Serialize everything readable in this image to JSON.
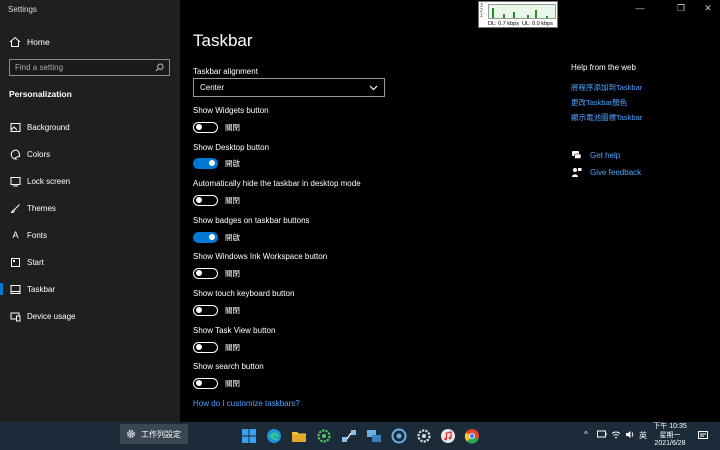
{
  "window": {
    "title": "Settings",
    "minimize": "—",
    "maximize": "❐",
    "close": "✕"
  },
  "sidebar": {
    "home": "Home",
    "search_placeholder": "Find a setting",
    "section": "Personalization",
    "items": [
      {
        "label": "Background",
        "icon": "picture-icon"
      },
      {
        "label": "Colors",
        "icon": "palette-icon"
      },
      {
        "label": "Lock screen",
        "icon": "lock-screen-icon"
      },
      {
        "label": "Themes",
        "icon": "brush-icon"
      },
      {
        "label": "Fonts",
        "icon": "font-icon"
      },
      {
        "label": "Start",
        "icon": "start-icon"
      },
      {
        "label": "Taskbar",
        "icon": "taskbar-icon",
        "active": true
      },
      {
        "label": "Device usage",
        "icon": "device-icon"
      }
    ]
  },
  "netmeter": {
    "scale": [
      "1",
      "2",
      "3"
    ],
    "download": "DL: 0.7 kbps",
    "upload": "UL: 0.0 kbps"
  },
  "main": {
    "title": "Taskbar",
    "alignment_label": "Taskbar alignment",
    "alignment_value": "Center",
    "settings": [
      {
        "label": "Show Widgets button",
        "state": "關閉",
        "on": false
      },
      {
        "label": "Show Desktop button",
        "state": "開啟",
        "on": true
      },
      {
        "label": "Automatically hide the taskbar in desktop mode",
        "state": "關閉",
        "on": false
      },
      {
        "label": "Show badges on taskbar buttons",
        "state": "開啟",
        "on": true
      },
      {
        "label": "Show Windows Ink Workspace button",
        "state": "關閉",
        "on": false
      },
      {
        "label": "Show touch keyboard button",
        "state": "關閉",
        "on": false
      },
      {
        "label": "Show Task View button",
        "state": "關閉",
        "on": false
      },
      {
        "label": "Show search button",
        "state": "關閉",
        "on": false
      }
    ],
    "customize_link": "How do I customize taskbars?"
  },
  "help": {
    "title": "Help from the web",
    "links": [
      "將程序添加到Taskbar",
      "更改Taskbar顏色",
      "顯示電池圖標Taskbar"
    ],
    "get_help": "Get help",
    "feedback": "Give feedback"
  },
  "taskbar": {
    "settings_app": "工作列設定",
    "tray_lang": "英",
    "time": "下午 10:35",
    "weekday": "星期一",
    "date": "2021/6/28"
  },
  "colors": {
    "accent": "#0078d4",
    "link": "#4da3ff",
    "sidebar_bg": "#1f1f1f",
    "taskbar_bg": "#1c2b3a"
  }
}
